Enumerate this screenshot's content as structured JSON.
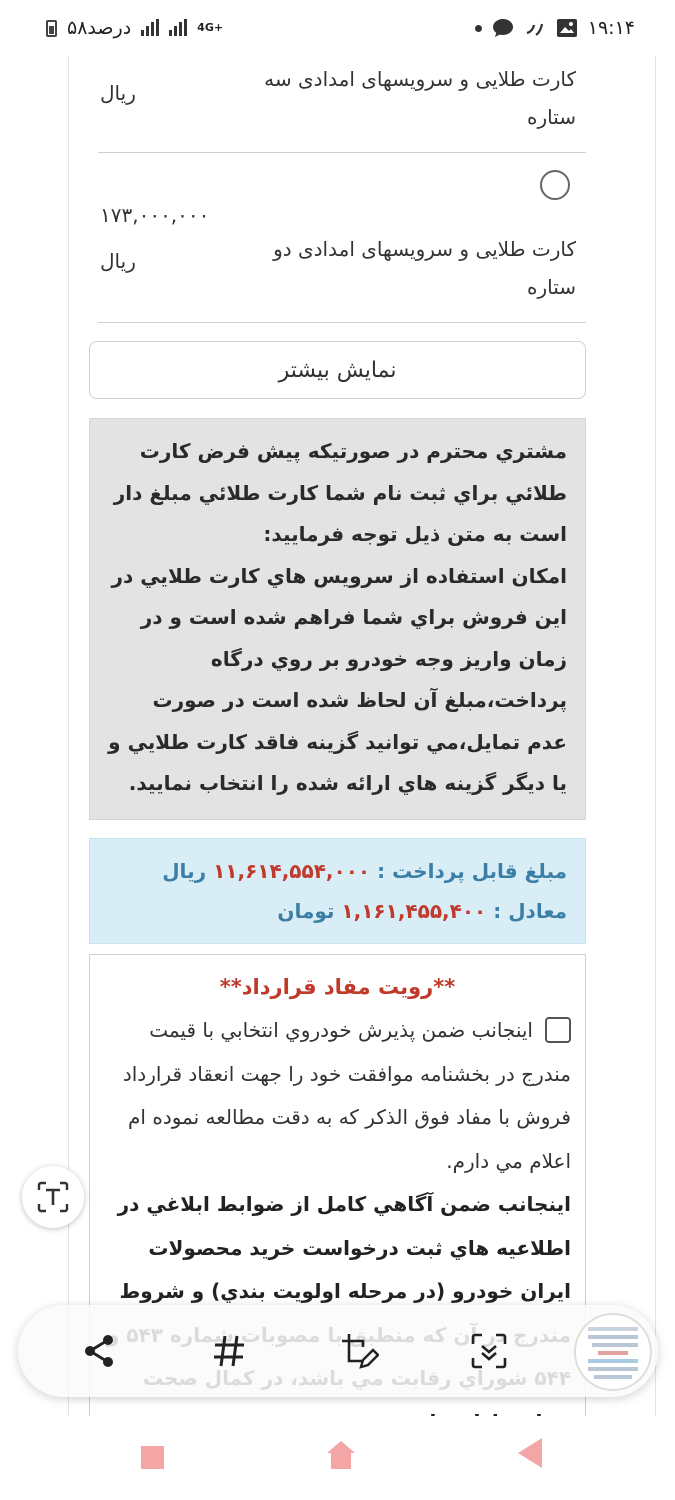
{
  "status_bar": {
    "time": "۱۹:۱۴",
    "battery": "۵۸درصد",
    "network": "4G+"
  },
  "options": [
    {
      "title": "کارت طلایی و سرویسهای امدادی سه ستاره",
      "unit": "ریال"
    },
    {
      "title": "کارت طلایی و سرویسهای امدادی دو ستاره",
      "price": "۱۷۳,۰۰۰,۰۰۰",
      "unit": "ریال"
    }
  ],
  "more_button": "نمایش بیشتر",
  "notice": {
    "intro": "مشتري محترم در صورتيكه پيش فرض كارت طلائي براي ثبت نام شما كارت طلائي مبلغ دار است به متن ذيل توجه فرماييد:",
    "body": "امكان استفاده از سرويس هاي كارت طلايي در اين فروش براي شما فراهم شده است و در زمان واريز وجه خودرو بر روي درگاه پرداخت،مبلغ آن لحاظ شده است در صورت عدم تمايل،مي توانيد گزينه فاقد كارت طلايي و يا ديگر گزينه هاي ارائه شده را انتخاب نماييد."
  },
  "amount": {
    "payable_label": "مبلغ قابل پرداخت :",
    "payable_value": "۱۱,۶۱۴,۵۵۴,۰۰۰",
    "payable_unit": "ریال",
    "equal_label": "معادل :",
    "equal_value": "۱,۱۶۱,۴۵۵,۴۰۰",
    "equal_unit": "تومان"
  },
  "contract": {
    "title": "**رویت مفاد قرارداد**",
    "accept_text": "اينجانب ضمن پذيرش خودروي انتخابي با قيمت مندرج در بخشنامه موافقت خود را جهت انعقاد قرارداد فروش با مفاد فوق الذكر كه به دقت مطالعه نموده ام اعلام مي دارم.",
    "bold_text": "اينجانب ضمن آگاهي كامل از ضوابط ابلاغي در اطلاعيه هاي ثبت درخواست خريد محصولات ايران خودرو (در مرحله اولويت بندي) و شروط مندرج در آن كه منطبق با مصوبات شماره ۵۴۳ و ۵۴۴ شوراي رقابت مي باشد، در كمال صحت عقل و اراده تاييد مي"
  },
  "colors": {
    "notice_bg": "#e3e3e3",
    "amount_bg": "#d9edf7",
    "amount_label": "#3b7ea6",
    "amount_value": "#c0392b",
    "contract_title": "#c0392b",
    "nav_accent": "#f4a6a6"
  }
}
